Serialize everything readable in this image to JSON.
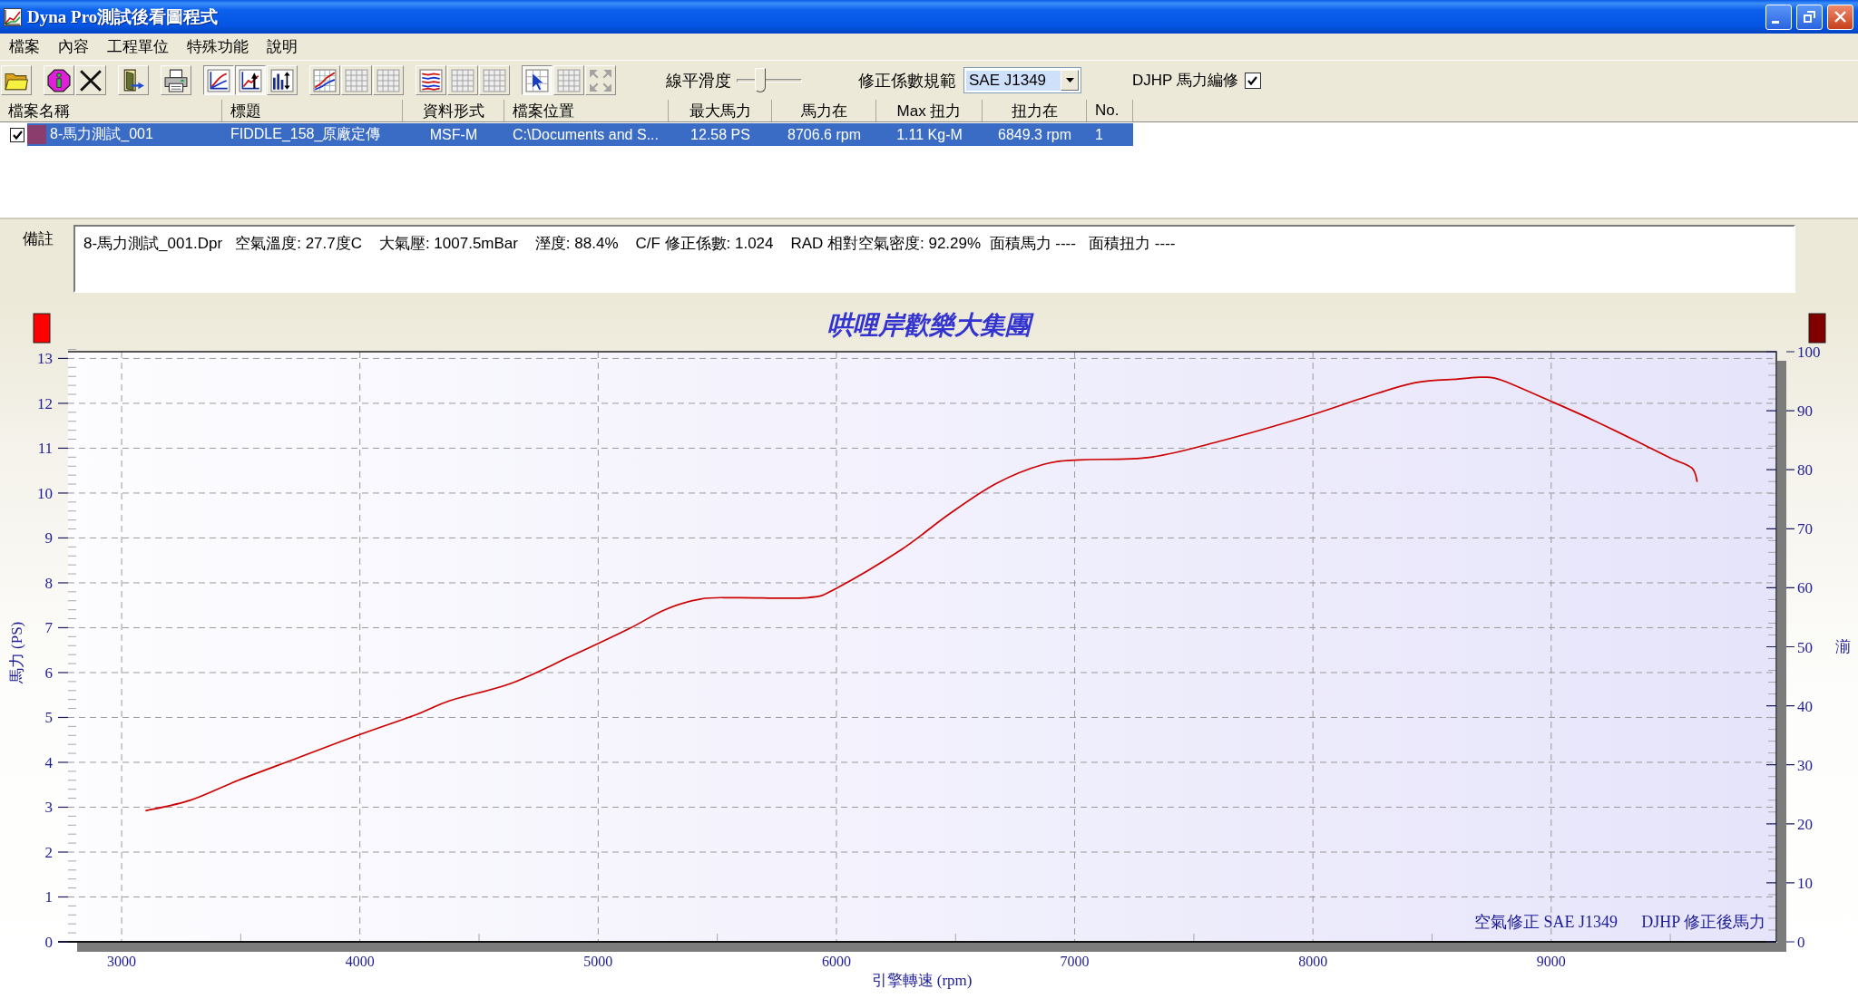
{
  "window": {
    "title": "Dyna Pro測試後看圖程式"
  },
  "menu": [
    "檔案",
    "內容",
    "工程單位",
    "特殊功能",
    "說明"
  ],
  "toolbar": {
    "buttons": [
      {
        "pressed": false,
        "disabled": false
      },
      {
        "pressed": false,
        "disabled": false
      },
      {
        "pressed": false,
        "disabled": false
      },
      {
        "pressed": false,
        "disabled": false
      },
      {
        "pressed": false,
        "disabled": false
      },
      {
        "pressed": true,
        "disabled": false
      },
      {
        "pressed": true,
        "disabled": false
      },
      {
        "pressed": false,
        "disabled": false
      },
      {
        "pressed": false,
        "disabled": false
      },
      {
        "pressed": false,
        "disabled": true
      },
      {
        "pressed": false,
        "disabled": true
      },
      {
        "pressed": false,
        "disabled": false
      },
      {
        "pressed": false,
        "disabled": true
      },
      {
        "pressed": false,
        "disabled": true
      },
      {
        "pressed": true,
        "disabled": false
      },
      {
        "pressed": false,
        "disabled": true
      },
      {
        "pressed": false,
        "disabled": true
      }
    ],
    "smoothing": {
      "label": "線平滑度",
      "level": 0.36
    },
    "correction": {
      "label": "修正係數規範",
      "value": "SAE J1349"
    },
    "djhp_edit": {
      "label": "DJHP 馬力編修",
      "checked": true
    }
  },
  "file_list": {
    "columns": [
      "檔案名稱",
      "標題",
      "資料形式",
      "檔案位置",
      "最大馬力",
      "馬力在",
      "Max 扭力",
      "扭力在",
      "No."
    ],
    "rows": [
      {
        "selected": true,
        "checked": true,
        "color": "#8b3d6e",
        "cells": [
          "8-馬力測試_001",
          "FIDDLE_158_原廠定傳",
          "MSF-M",
          "C:\\Documents and S...",
          "12.58 PS",
          "8706.6 rpm",
          "1.11 Kg-M",
          "6849.3 rpm",
          "1"
        ]
      }
    ]
  },
  "notes": {
    "label": "備註",
    "value": "8-馬力測試_001.Dpr   空氣溫度: 27.7度C    大氣壓: 1007.5mBar    溼度: 88.4%    C/F 修正係數: 1.024    RAD 相對空氣密度: 92.29%  面積馬力 ----   面積扭力 ----"
  },
  "chart": {
    "axis_markers": [
      {
        "color": "#ff0000"
      },
      {
        "color": "#800000"
      }
    ],
    "right_axis": {
      "label": "湔",
      "ticks": [
        "100",
        "90",
        "80",
        "70",
        "60",
        "50",
        "40",
        "30",
        "20",
        "10",
        "0"
      ]
    },
    "correction_note": "空氣修正 SAE J1349",
    "chart_data": {
      "type": "line",
      "title": "哄哩岸歡樂大集團",
      "xlabel": "引擎轉速 (rpm)",
      "ylabel": "馬力 (PS)",
      "x": [
        3100,
        3290,
        3490,
        3740,
        3990,
        4230,
        4380,
        4630,
        4880,
        5130,
        5280,
        5430,
        5580,
        5880,
        6000,
        6270,
        6470,
        6670,
        6870,
        7020,
        7320,
        7620,
        7970,
        8210,
        8430,
        8610,
        8707,
        8790,
        9010,
        9190,
        9380,
        9500,
        9590,
        9613
      ],
      "series": [
        {
          "name": "DJHP 修正後馬力",
          "color": "#cc0000",
          "values": [
            2.92,
            3.16,
            3.6,
            4.1,
            4.6,
            5.05,
            5.38,
            5.75,
            6.35,
            6.98,
            7.4,
            7.64,
            7.67,
            7.67,
            7.88,
            8.73,
            9.52,
            10.21,
            10.64,
            10.74,
            10.8,
            11.17,
            11.7,
            12.12,
            12.46,
            12.54,
            12.58,
            12.52,
            12.02,
            11.59,
            11.1,
            10.78,
            10.56,
            10.25
          ]
        }
      ],
      "xlim": [
        2775,
        9945
      ],
      "ylim": [
        0,
        13.15
      ],
      "xticks": [
        3000,
        4000,
        5000,
        6000,
        7000,
        8000,
        9000
      ],
      "yticks": [
        0,
        1,
        2,
        3,
        4,
        5,
        6,
        7,
        8,
        9,
        10,
        11,
        12,
        13
      ],
      "grid": true
    }
  }
}
